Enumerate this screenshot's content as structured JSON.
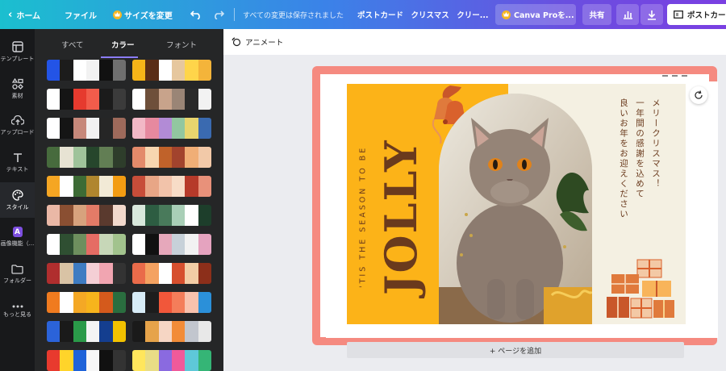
{
  "topbar": {
    "home_label": "ホーム",
    "file_label": "ファイル",
    "resize_label": "サイズを変更",
    "saved_status": "すべての変更は保存されました",
    "doc_title": "ポストカード　クリスマス　クリー...",
    "pro_label": "Canva Proを...",
    "share_label": "共有",
    "post_label": "ポストカー"
  },
  "rail": {
    "items": [
      {
        "label": "テンプレート",
        "icon": "template-icon"
      },
      {
        "label": "素材",
        "icon": "elements-icon"
      },
      {
        "label": "アップロード",
        "icon": "upload-icon"
      },
      {
        "label": "テキスト",
        "icon": "text-icon"
      },
      {
        "label": "スタイル",
        "icon": "style-icon"
      },
      {
        "label": "画像機能（...",
        "icon": "ai-icon"
      },
      {
        "label": "フォルダー",
        "icon": "folder-icon"
      },
      {
        "label": "もっと見る",
        "icon": "more-icon"
      }
    ]
  },
  "panel": {
    "tabs": [
      "すべて",
      "カラー",
      "フォント"
    ],
    "active_tab": "カラー"
  },
  "palettes": {
    "left": [
      [
        "#2354e6",
        "#1c1c1c",
        "#ffffff",
        "#f2f2f2",
        "#111111",
        "#6f6f6f"
      ],
      [
        "#ffffff",
        "#151515",
        "#e63a2e",
        "#f25c4b",
        "#1b1b1b",
        "#3b3b3b"
      ],
      [
        "#ffffff",
        "#151515",
        "#c6887a",
        "#f1f1f1",
        "#262626",
        "#9e6a5b"
      ],
      [
        "#476b3d",
        "#e7e3d3",
        "#9fc39a",
        "#26462c",
        "#627e54",
        "#2e3d2b"
      ],
      [
        "#f5a623",
        "#ffffff",
        "#3d6b35",
        "#b0862e",
        "#f2ead6",
        "#f39c12"
      ],
      [
        "#eab8a6",
        "#8a4f32",
        "#d7a27d",
        "#e37b67",
        "#5a3a2e",
        "#f2d9cc"
      ],
      [
        "#ffffff",
        "#2f4f32",
        "#6e8f5e",
        "#e56c64",
        "#c7d7b8",
        "#a2c38d"
      ],
      [
        "#b02e2e",
        "#d9c3a5",
        "#3e7cc2",
        "#f4cfd5",
        "#f1a5b1",
        "#333333"
      ],
      [
        "#f07b1f",
        "#ffffff",
        "#f4a825",
        "#f7b41c",
        "#d45a1c",
        "#2a6e3f"
      ],
      [
        "#2b63d9",
        "#1a1a1a",
        "#2a9a49",
        "#f4f4f4",
        "#143e8f",
        "#f2c200"
      ],
      [
        "#e83a2e",
        "#ffd42a",
        "#1f63d9",
        "#f7f7f7",
        "#111111",
        "#333333"
      ]
    ],
    "right": [
      [
        "#f6b418",
        "#5a2d16",
        "#ffffff",
        "#e6c79e",
        "#ffd54a",
        "#f4b43a"
      ],
      [
        "#ffffff",
        "#6e4f3a",
        "#c8a38b",
        "#9a8576",
        "#2a2a2a",
        "#f2f2f2"
      ],
      [
        "#f2b8c6",
        "#e6899f",
        "#b28bd6",
        "#92c7a0",
        "#e8d56e",
        "#3a6ab0"
      ],
      [
        "#e38a6a",
        "#f7d6b0",
        "#c0622a",
        "#a2432d",
        "#f0ae76",
        "#f2c9a8"
      ],
      [
        "#c74d39",
        "#e8a686",
        "#f2c3aa",
        "#f7dcc7",
        "#b63a2a",
        "#e8917a"
      ],
      [
        "#d8e8dc",
        "#2d5d42",
        "#497a5b",
        "#a9cfb7",
        "#ffffff",
        "#1d3e2b"
      ],
      [
        "#ffffff",
        "#111111",
        "#e6a8bb",
        "#c7d1d9",
        "#f2f2f2",
        "#e5a3bf"
      ],
      [
        "#e96b4a",
        "#f4a261",
        "#ffffff",
        "#d64f2e",
        "#f2cda5",
        "#8c2f1a"
      ],
      [
        "#d7ecf7",
        "#1d1d1d",
        "#f1573a",
        "#f47d5a",
        "#f9c2ad",
        "#2b90d9"
      ],
      [
        "#1a1a1a",
        "#e6a34a",
        "#f6d6c4",
        "#f28c38",
        "#c2c6ce",
        "#e8e8e8"
      ],
      [
        "#ffe65c",
        "#e9dd86",
        "#8a6ae0",
        "#f05a9a",
        "#5ec8d8",
        "#35b576"
      ]
    ]
  },
  "canvas": {
    "animate_label": "アニメート",
    "add_page_label": "+ ページを追加"
  },
  "card": {
    "tagline": "'TIS THE SEASON TO BE",
    "headline": "JOLLY",
    "message_lines": [
      "メリークリスマス！",
      "一年間の感謝を込めて",
      "良いお年をお迎えください"
    ],
    "colors": {
      "yellow": "#fcb318",
      "brown": "#6a3a1d",
      "cream": "#f4f0e2"
    }
  },
  "colors": {
    "topbar_start": "#1bbfcf",
    "topbar_end": "#7a3fe2",
    "selection_border": "#f58a80",
    "active_tab_underline": "#8b7cf6"
  }
}
